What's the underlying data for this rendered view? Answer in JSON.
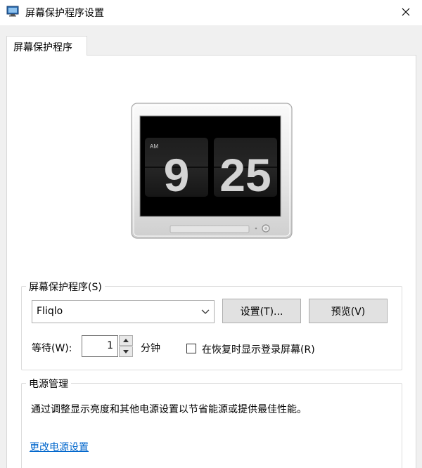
{
  "window": {
    "title": "屏幕保护程序设置",
    "icon": "display-settings-icon"
  },
  "tabs": [
    {
      "label": "屏幕保护程序",
      "active": true
    }
  ],
  "preview": {
    "clock_period": "AM",
    "clock_hour": "9",
    "clock_minute": "25"
  },
  "screensaver_group": {
    "label": "屏幕保护程序(S)",
    "selected": "Fliqlo",
    "settings_button": "设置(T)...",
    "preview_button": "预览(V)",
    "wait_label": "等待(W):",
    "wait_value": "1",
    "wait_unit": "分钟",
    "logon_checkbox_label": "在恢复时显示登录屏幕(R)",
    "logon_checkbox_checked": false
  },
  "power_group": {
    "label": "电源管理",
    "description": "通过调整显示亮度和其他电源设置以节省能源或提供最佳性能。",
    "link": "更改电源设置"
  },
  "colors": {
    "link": "#0066cc",
    "dialog_bg": "#f0f0f0",
    "button_bg": "#e1e1e1",
    "clock_digit": "#d4d4d4"
  }
}
